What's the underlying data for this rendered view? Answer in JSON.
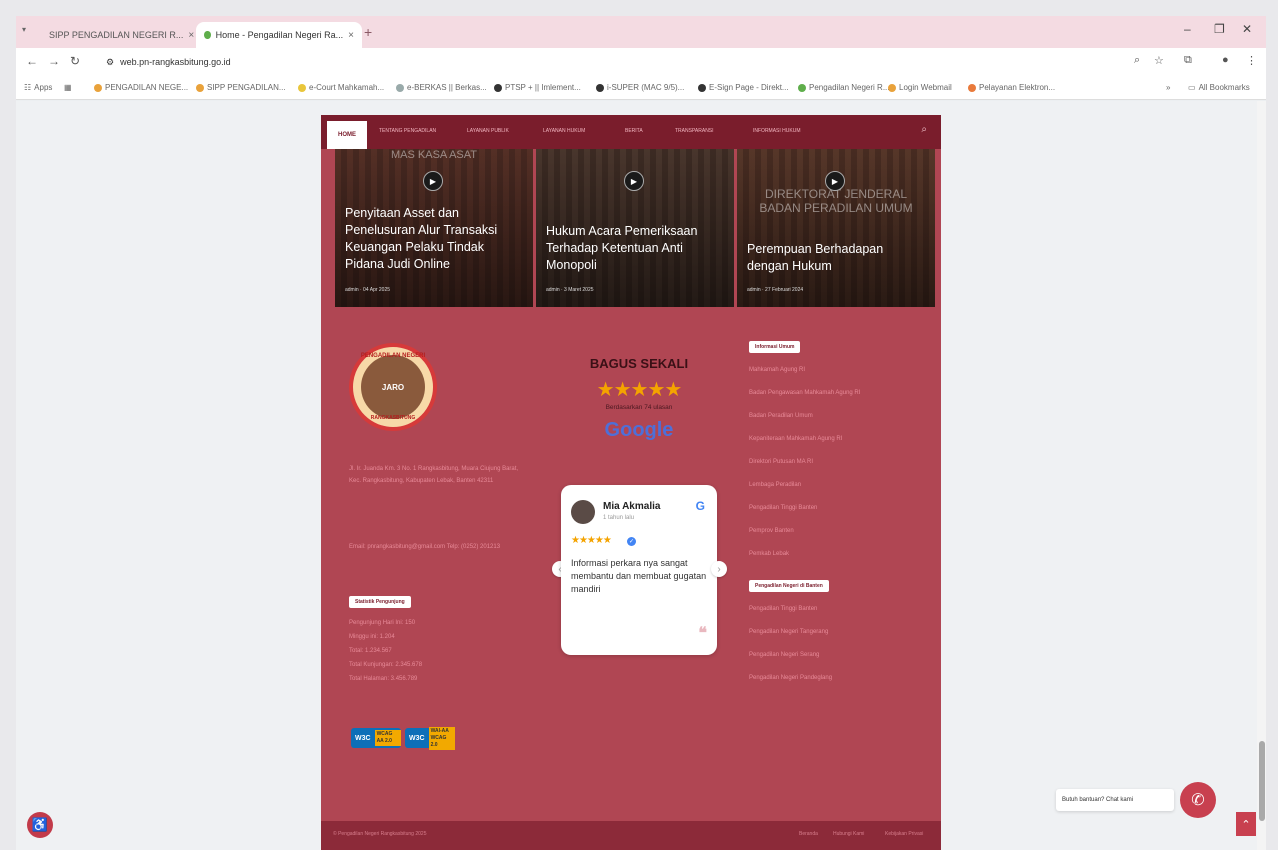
{
  "browser": {
    "tabs": [
      {
        "label": "SIPP PENGADILAN NEGERI R..."
      },
      {
        "label": "Home - Pengadilan Negeri Ra..."
      }
    ],
    "new_tab": "+",
    "url": "web.pn-rangkasbitung.go.id",
    "bookmarks": [
      {
        "label": "Apps"
      },
      {
        "label": "PENGADILAN NEGE..."
      },
      {
        "label": "SIPP PENGADILAN..."
      },
      {
        "label": "e-Court Mahkamah..."
      },
      {
        "label": "e-BERKAS || Berkas..."
      },
      {
        "label": "PTSP + || Imlement..."
      },
      {
        "label": "i-SUPER (MAC 9/5)..."
      },
      {
        "label": "E-Sign Page - Direkt..."
      },
      {
        "label": "Pengadilan Negeri R..."
      },
      {
        "label": "Login Webmail"
      },
      {
        "label": "Pelayanan Elektron..."
      }
    ],
    "all_bookmarks": "All Bookmarks",
    "more_bookmarks": "»"
  },
  "nav": {
    "home": "HOME",
    "items": [
      "TENTANG PENGADILAN",
      "LAYANAN PUBLIK",
      "LAYANAN HUKUM",
      "BERITA",
      "TRANSPARANSI",
      "INFORMASI HUKUM"
    ]
  },
  "videos": [
    {
      "overlay": "MAS KASA ASAT",
      "title": "Penyitaan Asset dan Penelusuran Alur Transaksi Keuangan Pelaku Tindak Pidana Judi Online",
      "meta": "admin · 04 Apr 2025"
    },
    {
      "overlay": "",
      "title": "Hukum Acara Pemeriksaan Terhadap Ketentuan Anti Monopoli",
      "meta": "admin · 3 Maret 2025"
    },
    {
      "overlay": "DIREKTORAT JENDERAL BADAN PERADILAN UMUM",
      "title": "Perempuan Berhadapan dengan Hukum",
      "meta": "admin · 27 Februari 2024"
    }
  ],
  "footer": {
    "logo_top": "PENGADILAN NEGERI",
    "logo_mid": "JARO",
    "logo_bottom": "RANGKASBITUNG",
    "address": "Jl. Ir. Juanda Km. 3 No. 1 Rangkasbitung, Muara Ciujung Barat, Kec. Rangkasbitung, Kabupaten Lebak, Banten 42311",
    "contact": "Email: pnrangkasbitung@gmail.com Telp: (0252) 201213",
    "visitor_label": "Statistik Pengunjung",
    "stats": [
      "Pengunjung Hari Ini: 150",
      "Minggu ini: 1.204",
      "Total: 1.234.567",
      "Total Kunjungan: 2.345.678",
      "Total Halaman: 3.456.789"
    ],
    "wcag1": {
      "badge": "W3C",
      "tag": "WCAG AA 2.0"
    },
    "wcag2": {
      "badge": "W3C",
      "tag": "WAI-AA WCAG 2.0"
    }
  },
  "rating": {
    "title": "BAGUS SEKALI",
    "stars": "★★★★★",
    "based_on": "Berdasarkan 74 ulasan",
    "google": "Google"
  },
  "review": {
    "name": "Mia Akmalia",
    "time": "1 tahun lalu",
    "stars": "★★★★★",
    "text": "Informasi perkara nya sangat membantu dan membuat gugatan mandiri",
    "quote": "❝",
    "prev": "‹",
    "next": "›"
  },
  "links_info": {
    "label": "Informasi Umum",
    "items": [
      "Mahkamah Agung RI",
      "Badan Pengawasan Mahkamah Agung RI",
      "Badan Peradilan Umum",
      "Kepaniteraan Mahkamah Agung RI",
      "Direktori Putusan MA RI",
      "Lembaga Peradilan",
      "Pengadilan Tinggi Banten",
      "Pemprov Banten",
      "Pemkab Lebak"
    ]
  },
  "links_courts": {
    "label": "Pengadilan Negeri di Banten",
    "items": [
      "Pengadilan Tinggi Banten",
      "Pengadilan Negeri Tangerang",
      "Pengadilan Negeri Serang",
      "Pengadilan Negeri Pandeglang"
    ]
  },
  "bottom": {
    "copyright": "© Pengadilan Negeri Rangkasbitung 2025",
    "links": [
      "Beranda",
      "Hubungi Kami",
      "Kebijakan Privasi"
    ]
  },
  "whatsapp": {
    "label": "Butuh bantuan? Chat kami"
  },
  "icons": {
    "play": "▶",
    "search": "⌕",
    "access": "♿",
    "totop": "⌃",
    "whatsapp": "✆"
  }
}
